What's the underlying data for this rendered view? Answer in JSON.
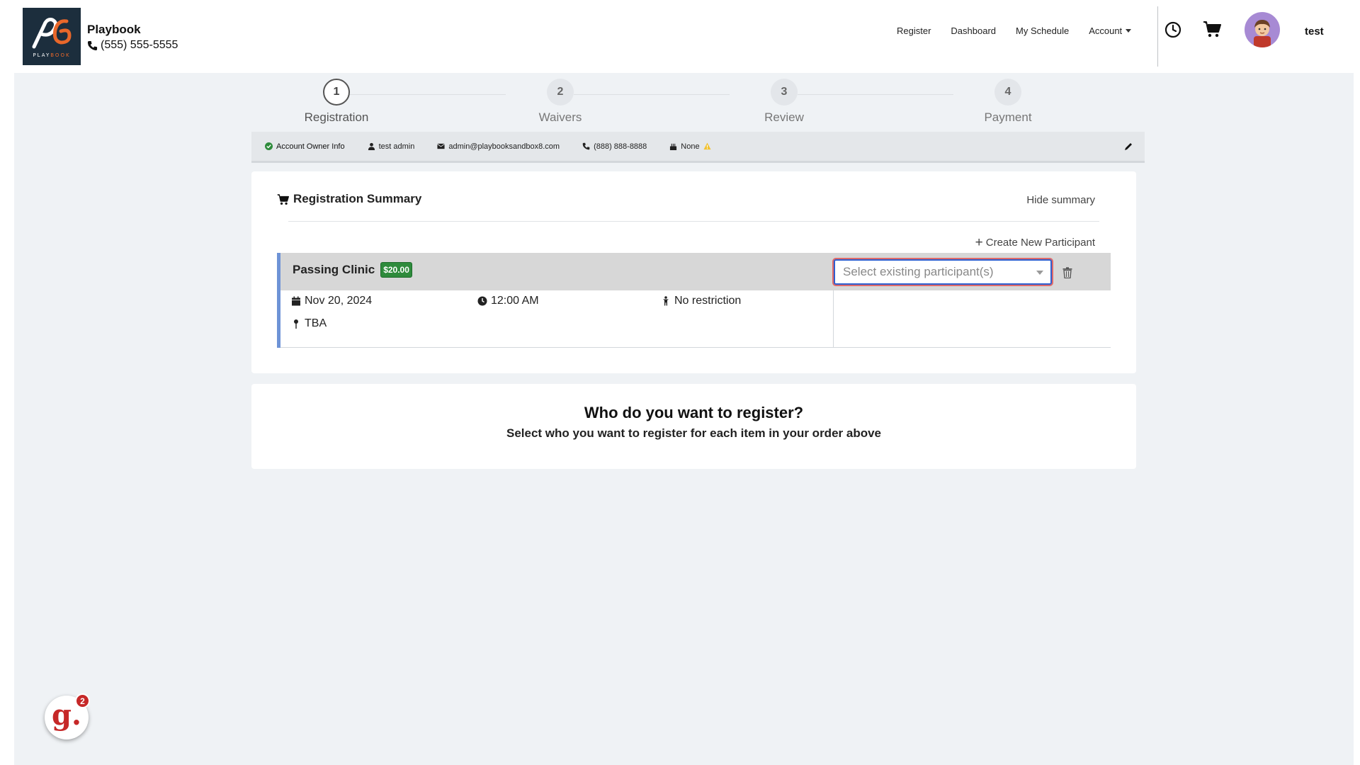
{
  "brand": {
    "name": "Playbook",
    "phone": "(555) 555-5555",
    "logo_text": "PLAYBOOK"
  },
  "nav": {
    "register": "Register",
    "dashboard": "Dashboard",
    "my_schedule": "My Schedule",
    "account": "Account"
  },
  "user": {
    "name": "test"
  },
  "steps": [
    {
      "number": "1",
      "label": "Registration",
      "active": true
    },
    {
      "number": "2",
      "label": "Waivers",
      "active": false
    },
    {
      "number": "3",
      "label": "Review",
      "active": false
    },
    {
      "number": "4",
      "label": "Payment",
      "active": false
    }
  ],
  "owner": {
    "title": "Account Owner Info",
    "name": "test admin",
    "email": "admin@playbooksandbox8.com",
    "phone": "(888) 888-8888",
    "dob": "None"
  },
  "summary": {
    "title": "Registration Summary",
    "hide_label": "Hide summary",
    "create_label": "Create New Participant",
    "item": {
      "name": "Passing Clinic",
      "price": "$20.00",
      "select_placeholder": "Select existing participant(s)",
      "date": "Nov 20, 2024",
      "time": "12:00 AM",
      "restriction": "No restriction",
      "location": "TBA"
    }
  },
  "who": {
    "title": "Who do you want to register?",
    "subtitle": "Select who you want to register for each item in your order above"
  },
  "widget": {
    "badge": "2",
    "letter": "g."
  },
  "colors": {
    "accent_blue": "#6e93d6",
    "price_green": "#2e8b3c",
    "logo_bg": "#1c2e3d",
    "logo_orange": "#e8672a",
    "widget_red": "#c62828",
    "page_bg": "#eff2f5"
  }
}
